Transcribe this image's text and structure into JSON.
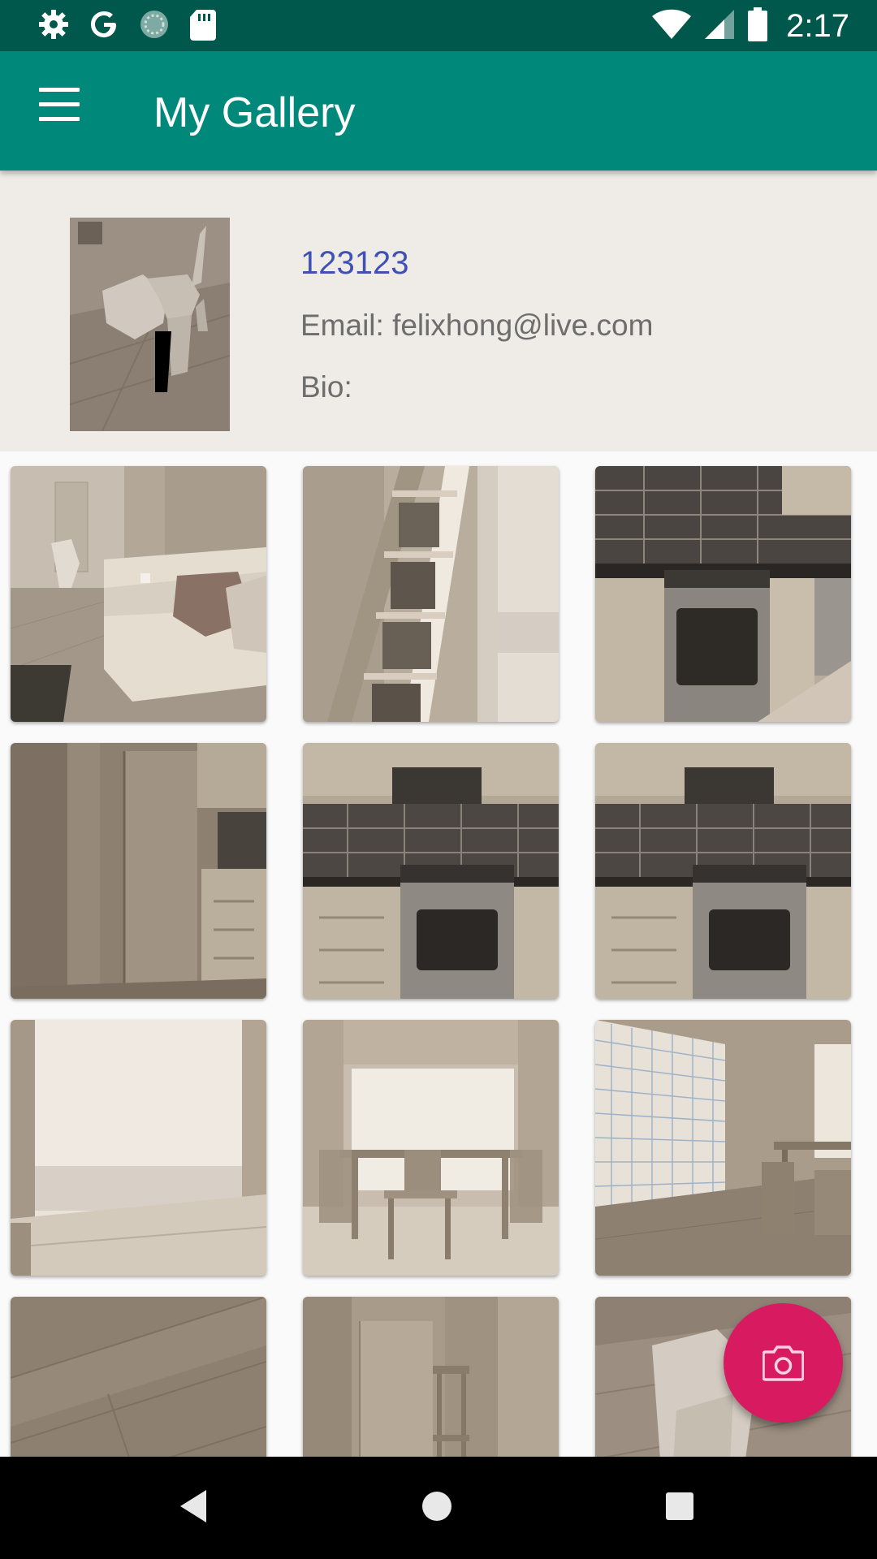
{
  "status_bar": {
    "time": "2:17",
    "left_icons": [
      "settings-icon",
      "google-icon",
      "sync-icon",
      "sd-card-icon"
    ],
    "right_icons": [
      "wifi-icon",
      "cell-signal-icon",
      "battery-icon"
    ]
  },
  "app_bar": {
    "title": "My Gallery",
    "menu_icon": "hamburger-menu-icon"
  },
  "profile": {
    "name": "123123",
    "email": "Email: felixhong@live.com",
    "bio": "Bio:"
  },
  "gallery": {
    "photos": [
      "living-room-sofa",
      "bookshelf-ladder",
      "kitchen-oven",
      "hallway-door",
      "kitchen-stove-hood",
      "kitchen-stove-hood",
      "window-blind",
      "dining-table",
      "window-grid-dining",
      "wood-floor",
      "entry-door",
      "dog-closeup"
    ]
  },
  "fab": {
    "icon": "camera-icon"
  },
  "nav_bar": {
    "icons": [
      "back-icon",
      "home-icon",
      "recents-icon"
    ]
  },
  "colors": {
    "status_bar": "#00574b",
    "app_bar": "#00897b",
    "profile_bg": "#efebe7",
    "name_color": "#3f51b5",
    "fab": "#d81b60"
  }
}
